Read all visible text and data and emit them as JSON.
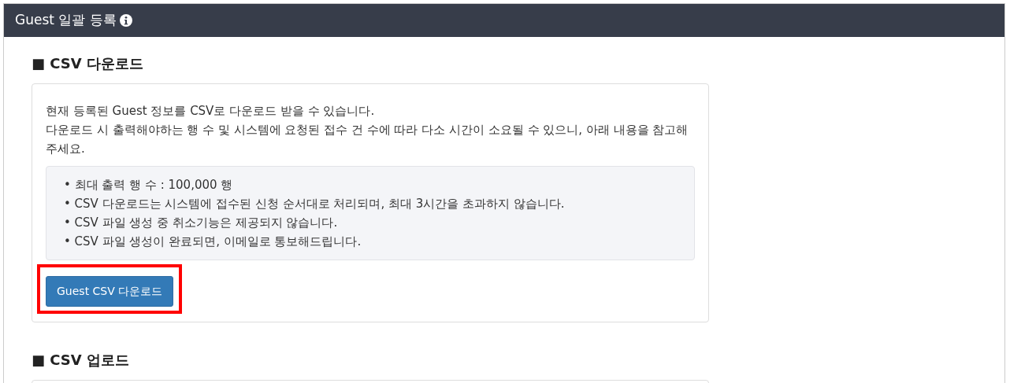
{
  "panel": {
    "title": "Guest 일괄 등록"
  },
  "sections": [
    {
      "heading": "■ CSV 다운로드",
      "paragraph": [
        "현재 등록된 Guest 정보를 CSV로 다운로드 받을 수 있습니다.",
        "다운로드 시 출력해야하는 행 수 및 시스템에 요청된 접수 건 수에 따라 다소 시간이 소요될 수 있으니, 아래 내용을 참고해주세요."
      ],
      "notes": [
        "• 최대 출력 행 수 : 100,000 행",
        "• CSV 다운로드는 시스템에 접수된 신청 순서대로 처리되며, 최대 3시간을 초과하지 않습니다.",
        "• CSV 파일 생성 중 취소기능은 제공되지 않습니다.",
        "• CSV 파일 생성이 완료되면, 이메일로 통보해드립니다."
      ],
      "button": {
        "label": "Guest CSV 다운로드",
        "highlighted": true
      }
    },
    {
      "heading": "■ CSV 업로드"
    }
  ]
}
